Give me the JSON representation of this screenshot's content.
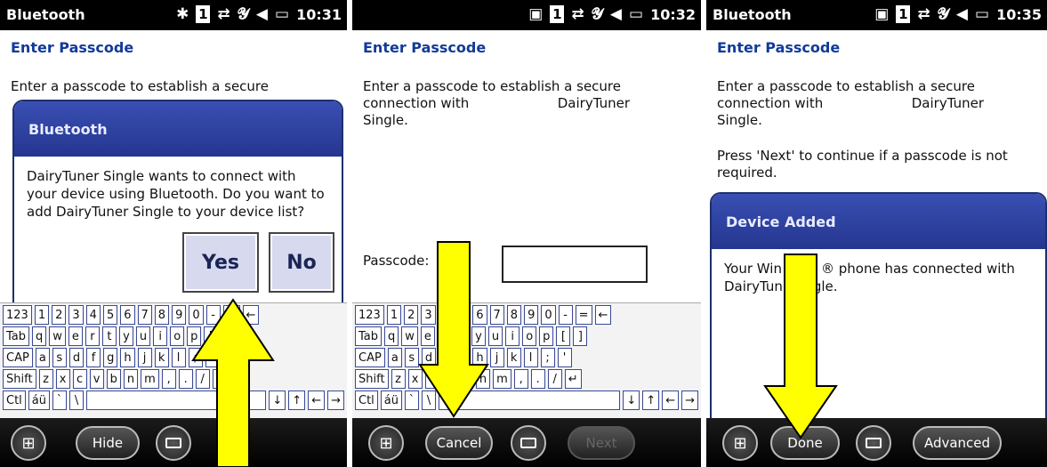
{
  "screens": [
    {
      "status": {
        "app": "Bluetooth",
        "time": "10:31",
        "slot": "1"
      },
      "subheader": "Enter Passcode",
      "intro": "Enter a passcode to establish a secure",
      "dialog": {
        "title": "Bluetooth",
        "message": "DairyTuner Single wants to connect with your device using Bluetooth. Do you want to add DairyTuner Single to your device list?",
        "yes": "Yes",
        "no": "No"
      },
      "bottombar": {
        "hide": "Hide"
      }
    },
    {
      "status": {
        "app": "",
        "time": "10:32",
        "slot": "1"
      },
      "subheader": "Enter Passcode",
      "intro_line1": "Enter a passcode to establish a secure",
      "intro_line2a": "connection with",
      "intro_line2b": "DairyTuner",
      "intro_line3": "Single.",
      "passcode_label": "Passcode:",
      "passcode_value": "",
      "bottombar": {
        "cancel": "Cancel",
        "next": "Next"
      }
    },
    {
      "status": {
        "app": "Bluetooth",
        "time": "10:35",
        "slot": "1"
      },
      "subheader": "Enter Passcode",
      "intro_line1": "Enter a passcode to establish a secure",
      "intro_line2a": "connection with",
      "intro_line2b": "DairyTuner",
      "intro_line3": "Single.",
      "press_next": "Press 'Next' to continue if a passcode is not required.",
      "dialog": {
        "title": "Device Added",
        "line1_a": "Your Win",
        "line1_b": "® phone has connected with",
        "line2_a": "DairyTun",
        "line2_b": "gle."
      },
      "bottombar": {
        "done": "Done",
        "advanced": "Advanced"
      }
    }
  ],
  "keyboard": {
    "row1": [
      "123",
      "1",
      "2",
      "3",
      "4",
      "5",
      "6",
      "7",
      "8",
      "9",
      "0",
      "-",
      "=",
      "←"
    ],
    "row2": [
      "Tab",
      "q",
      "w",
      "e",
      "r",
      "t",
      "y",
      "u",
      "i",
      "o",
      "p",
      "[",
      "]"
    ],
    "row3": [
      "CAP",
      "a",
      "s",
      "d",
      "f",
      "g",
      "h",
      "j",
      "k",
      "l",
      ";",
      "'"
    ],
    "row4": [
      "Shift",
      "z",
      "x",
      "c",
      "v",
      "b",
      "n",
      "m",
      ",",
      ".",
      "/",
      "↵"
    ],
    "row5": [
      "Ctl",
      "áü",
      "`",
      "\\",
      "",
      "↓",
      "↑",
      "←",
      "→"
    ]
  },
  "colors": {
    "accent": "#123a9a",
    "dialog_title": "#2c3f9e",
    "arrow": "#ffff00"
  },
  "icons": {
    "bluetooth": "bluetooth-icon",
    "windows": "windows-start-icon",
    "keyboard": "keyboard-icon"
  }
}
